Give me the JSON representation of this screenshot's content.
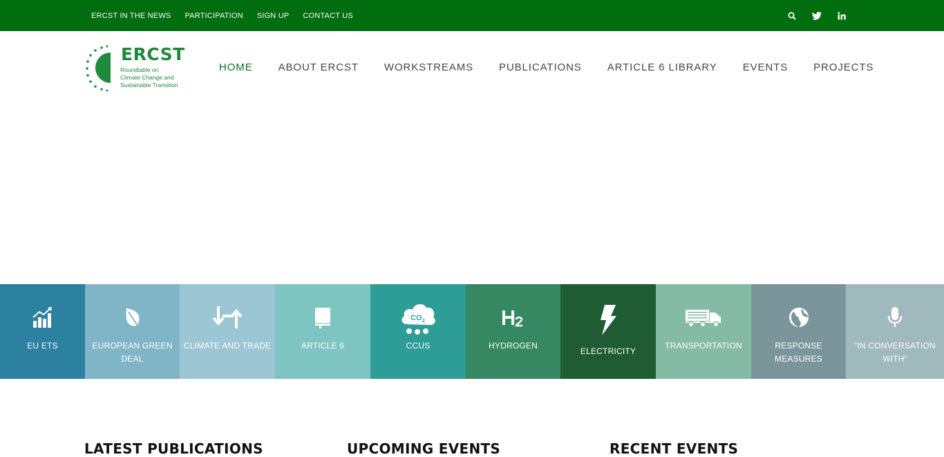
{
  "top_nav": [
    "ERCST IN THE NEWS",
    "PARTICIPATION",
    "SIGN UP",
    "CONTACT US"
  ],
  "top_icons": [
    "search-icon",
    "twitter-icon",
    "linkedin-icon"
  ],
  "logo": {
    "word": "ERCST",
    "subtitle": [
      "Roundtable on",
      "Climate Change and",
      "Sustainable Transition"
    ]
  },
  "main_nav": [
    {
      "label": "HOME",
      "active": true
    },
    {
      "label": "ABOUT ERCST",
      "active": false
    },
    {
      "label": "WORKSTREAMS",
      "active": false
    },
    {
      "label": "PUBLICATIONS",
      "active": false
    },
    {
      "label": "ARTICLE 6 LIBRARY",
      "active": false
    },
    {
      "label": "EVENTS",
      "active": false
    },
    {
      "label": "PROJECTS",
      "active": false
    }
  ],
  "tiles": [
    {
      "label": "EU ETS",
      "icon": "bar-chart-icon",
      "color": "#2c80a0"
    },
    {
      "label": "EUROPEAN GREEN DEAL",
      "icon": "leaf-icon",
      "color": "#7fb5c6"
    },
    {
      "label": "CLIMATE AND TRADE",
      "icon": "arrows-up-down-icon",
      "color": "#9cc6d3"
    },
    {
      "label": "ARTICLE 6",
      "icon": "book-icon",
      "color": "#7ec5c2"
    },
    {
      "label": "CCUS",
      "icon": "co2-cloud-icon",
      "color": "#2e9c97"
    },
    {
      "label": "HYDROGEN",
      "icon": "h2-icon",
      "color": "#358862"
    },
    {
      "label": "ELECTRICITY",
      "icon": "lightning-icon",
      "color": "#1f5c33"
    },
    {
      "label": "TRANSPORTATION",
      "icon": "truck-icon",
      "color": "#85bba5"
    },
    {
      "label": "RESPONSE MEASURES",
      "icon": "globe-icon",
      "color": "#7a969b"
    },
    {
      "label": "“IN CONVERSATION WITH”",
      "icon": "microphone-icon",
      "color": "#a0b9bd"
    }
  ],
  "sections": [
    "LATEST PUBLICATIONS",
    "UPCOMING EVENTS",
    "RECENT EVENTS"
  ],
  "colors": {
    "topbar": "#006d0f",
    "brand_green": "#1f8a3b",
    "nav_active": "#0b6e1d"
  }
}
